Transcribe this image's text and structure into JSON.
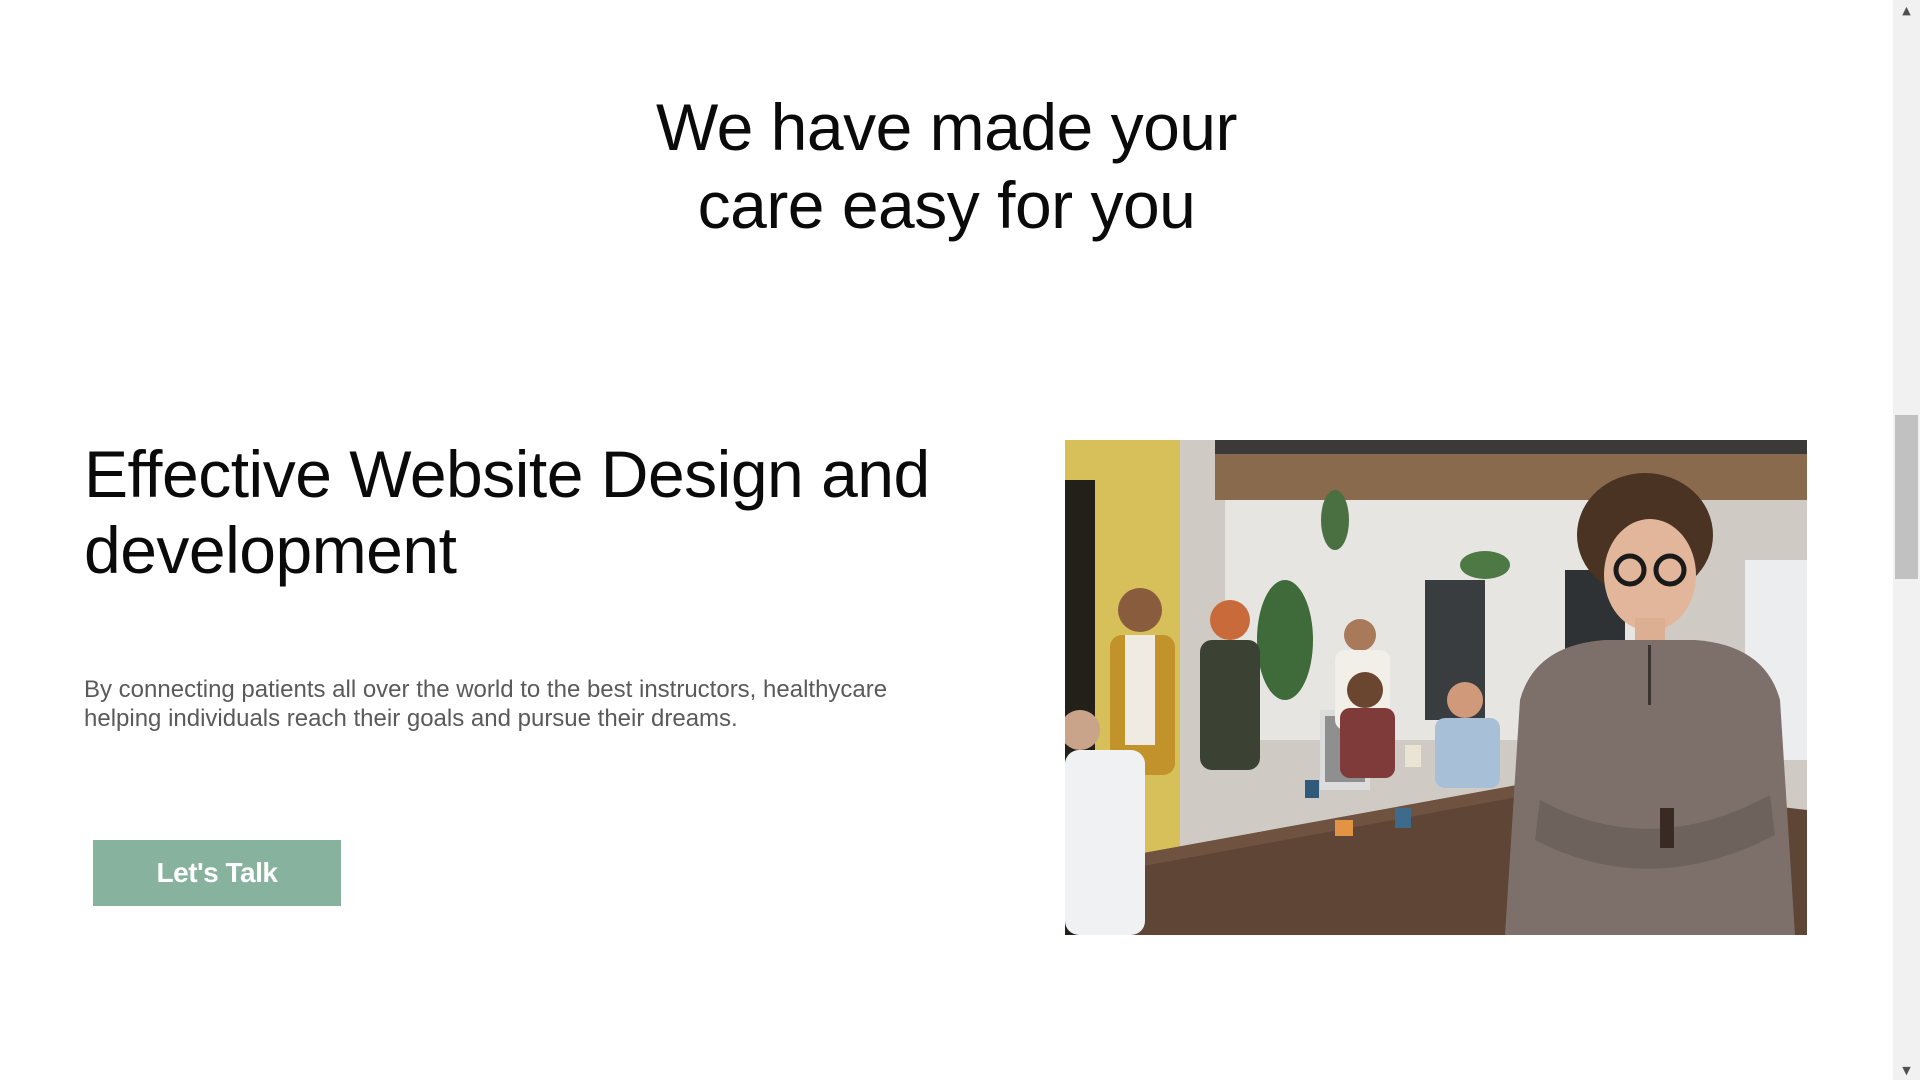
{
  "section": {
    "title_line1": "We have made your",
    "title_line2": "care easy for you"
  },
  "feature": {
    "heading_line1": "Effective Website Design and",
    "heading_line2": "development",
    "description_line1": "By connecting patients all over the world to the best instructors, healthycare",
    "description_line2": "helping individuals reach their goals and pursue their dreams.",
    "cta_label": "Let's Talk",
    "image_alt": "Team photo with woman in foreground"
  },
  "colors": {
    "cta_background": "#87b29d",
    "heading_text": "#0a0a0a",
    "body_text": "#5a5a5a",
    "page_background": "#ffffff"
  },
  "scrollbar": {
    "up_icon": "chevron-up-icon",
    "down_icon": "chevron-down-icon"
  }
}
